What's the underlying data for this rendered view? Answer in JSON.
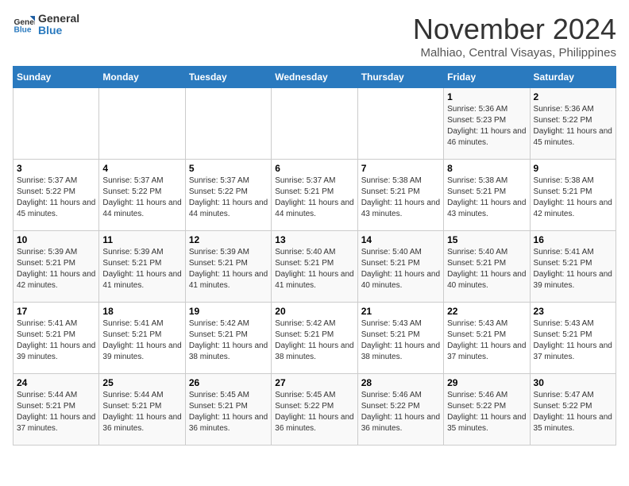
{
  "logo": {
    "line1": "General",
    "line2": "Blue"
  },
  "header": {
    "month_title": "November 2024",
    "subtitle": "Malhiao, Central Visayas, Philippines"
  },
  "days_of_week": [
    "Sunday",
    "Monday",
    "Tuesday",
    "Wednesday",
    "Thursday",
    "Friday",
    "Saturday"
  ],
  "weeks": [
    [
      {
        "day": "",
        "info": ""
      },
      {
        "day": "",
        "info": ""
      },
      {
        "day": "",
        "info": ""
      },
      {
        "day": "",
        "info": ""
      },
      {
        "day": "",
        "info": ""
      },
      {
        "day": "1",
        "info": "Sunrise: 5:36 AM\nSunset: 5:23 PM\nDaylight: 11 hours and 46 minutes."
      },
      {
        "day": "2",
        "info": "Sunrise: 5:36 AM\nSunset: 5:22 PM\nDaylight: 11 hours and 45 minutes."
      }
    ],
    [
      {
        "day": "3",
        "info": "Sunrise: 5:37 AM\nSunset: 5:22 PM\nDaylight: 11 hours and 45 minutes."
      },
      {
        "day": "4",
        "info": "Sunrise: 5:37 AM\nSunset: 5:22 PM\nDaylight: 11 hours and 44 minutes."
      },
      {
        "day": "5",
        "info": "Sunrise: 5:37 AM\nSunset: 5:22 PM\nDaylight: 11 hours and 44 minutes."
      },
      {
        "day": "6",
        "info": "Sunrise: 5:37 AM\nSunset: 5:21 PM\nDaylight: 11 hours and 44 minutes."
      },
      {
        "day": "7",
        "info": "Sunrise: 5:38 AM\nSunset: 5:21 PM\nDaylight: 11 hours and 43 minutes."
      },
      {
        "day": "8",
        "info": "Sunrise: 5:38 AM\nSunset: 5:21 PM\nDaylight: 11 hours and 43 minutes."
      },
      {
        "day": "9",
        "info": "Sunrise: 5:38 AM\nSunset: 5:21 PM\nDaylight: 11 hours and 42 minutes."
      }
    ],
    [
      {
        "day": "10",
        "info": "Sunrise: 5:39 AM\nSunset: 5:21 PM\nDaylight: 11 hours and 42 minutes."
      },
      {
        "day": "11",
        "info": "Sunrise: 5:39 AM\nSunset: 5:21 PM\nDaylight: 11 hours and 41 minutes."
      },
      {
        "day": "12",
        "info": "Sunrise: 5:39 AM\nSunset: 5:21 PM\nDaylight: 11 hours and 41 minutes."
      },
      {
        "day": "13",
        "info": "Sunrise: 5:40 AM\nSunset: 5:21 PM\nDaylight: 11 hours and 41 minutes."
      },
      {
        "day": "14",
        "info": "Sunrise: 5:40 AM\nSunset: 5:21 PM\nDaylight: 11 hours and 40 minutes."
      },
      {
        "day": "15",
        "info": "Sunrise: 5:40 AM\nSunset: 5:21 PM\nDaylight: 11 hours and 40 minutes."
      },
      {
        "day": "16",
        "info": "Sunrise: 5:41 AM\nSunset: 5:21 PM\nDaylight: 11 hours and 39 minutes."
      }
    ],
    [
      {
        "day": "17",
        "info": "Sunrise: 5:41 AM\nSunset: 5:21 PM\nDaylight: 11 hours and 39 minutes."
      },
      {
        "day": "18",
        "info": "Sunrise: 5:41 AM\nSunset: 5:21 PM\nDaylight: 11 hours and 39 minutes."
      },
      {
        "day": "19",
        "info": "Sunrise: 5:42 AM\nSunset: 5:21 PM\nDaylight: 11 hours and 38 minutes."
      },
      {
        "day": "20",
        "info": "Sunrise: 5:42 AM\nSunset: 5:21 PM\nDaylight: 11 hours and 38 minutes."
      },
      {
        "day": "21",
        "info": "Sunrise: 5:43 AM\nSunset: 5:21 PM\nDaylight: 11 hours and 38 minutes."
      },
      {
        "day": "22",
        "info": "Sunrise: 5:43 AM\nSunset: 5:21 PM\nDaylight: 11 hours and 37 minutes."
      },
      {
        "day": "23",
        "info": "Sunrise: 5:43 AM\nSunset: 5:21 PM\nDaylight: 11 hours and 37 minutes."
      }
    ],
    [
      {
        "day": "24",
        "info": "Sunrise: 5:44 AM\nSunset: 5:21 PM\nDaylight: 11 hours and 37 minutes."
      },
      {
        "day": "25",
        "info": "Sunrise: 5:44 AM\nSunset: 5:21 PM\nDaylight: 11 hours and 36 minutes."
      },
      {
        "day": "26",
        "info": "Sunrise: 5:45 AM\nSunset: 5:21 PM\nDaylight: 11 hours and 36 minutes."
      },
      {
        "day": "27",
        "info": "Sunrise: 5:45 AM\nSunset: 5:22 PM\nDaylight: 11 hours and 36 minutes."
      },
      {
        "day": "28",
        "info": "Sunrise: 5:46 AM\nSunset: 5:22 PM\nDaylight: 11 hours and 36 minutes."
      },
      {
        "day": "29",
        "info": "Sunrise: 5:46 AM\nSunset: 5:22 PM\nDaylight: 11 hours and 35 minutes."
      },
      {
        "day": "30",
        "info": "Sunrise: 5:47 AM\nSunset: 5:22 PM\nDaylight: 11 hours and 35 minutes."
      }
    ]
  ]
}
